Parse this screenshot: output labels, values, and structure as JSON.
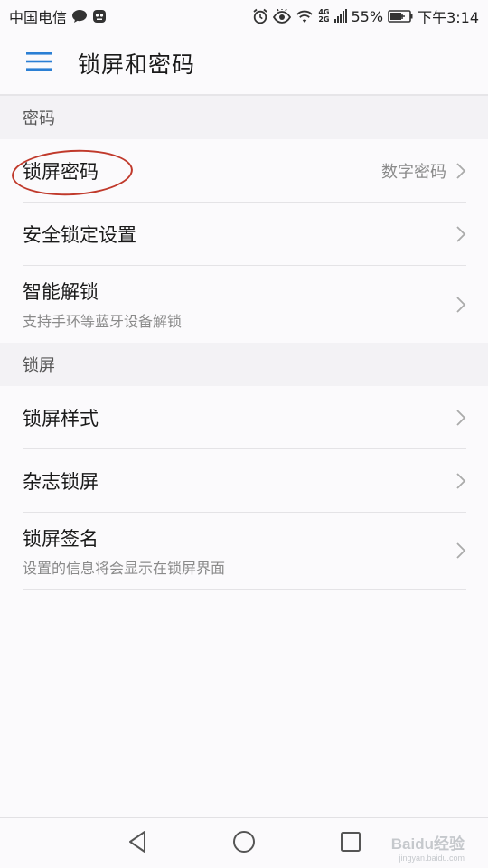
{
  "status_bar": {
    "carrier": "中国电信",
    "network_top": "4G",
    "network_bottom": "2G",
    "battery": "55%",
    "time": "下午3:14",
    "icons": [
      "chat-bubble-icon",
      "robot-icon",
      "alarm-icon",
      "eye-icon",
      "wifi-icon",
      "signal-icon",
      "battery-icon"
    ]
  },
  "app_bar": {
    "title": "锁屏和密码",
    "menu_icon": "hamburger-menu-icon"
  },
  "sections": {
    "password": {
      "header": "密码",
      "items": [
        {
          "title": "锁屏密码",
          "value": "数字密码"
        },
        {
          "title": "安全锁定设置"
        },
        {
          "title": "智能解锁",
          "subtitle": "支持手环等蓝牙设备解锁"
        }
      ]
    },
    "lockscreen": {
      "header": "锁屏",
      "items": [
        {
          "title": "锁屏样式"
        },
        {
          "title": "杂志锁屏"
        },
        {
          "title": "锁屏签名",
          "subtitle": "设置的信息将会显示在锁屏界面"
        }
      ]
    }
  },
  "nav_bar": {
    "icons": [
      "back-icon",
      "home-icon",
      "recents-icon"
    ]
  },
  "watermark": {
    "main": "Baidu经验",
    "sub": "jingyan.baidu.com"
  },
  "colors": {
    "accent": "#2b7fd4",
    "highlight": "#c0392b"
  }
}
